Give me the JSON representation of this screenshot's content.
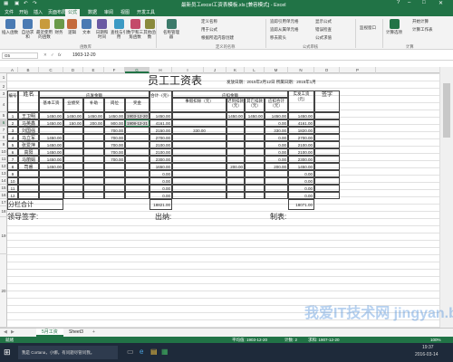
{
  "app": {
    "title": "最新员工excel工资表模板.xls  [兼容模式] - Excel",
    "file_tab": "文件"
  },
  "ribbon_tabs": [
    "文件",
    "开始",
    "插入",
    "页面布局",
    "公式",
    "数据",
    "审阅",
    "视图",
    "开发工具"
  ],
  "active_tab": "公式",
  "ribbon": {
    "buttons": [
      {
        "label": "插入函数",
        "color": "#4a7ab3"
      },
      {
        "label": "自动求和",
        "color": "#4a7ab3"
      },
      {
        "label": "最近使用的函数",
        "color": "#c89b3c"
      },
      {
        "label": "财务",
        "color": "#6a9a4a"
      },
      {
        "label": "逻辑",
        "color": "#c46a3c"
      },
      {
        "label": "文本",
        "color": "#4a7ab3"
      },
      {
        "label": "日期和时间",
        "color": "#6a5aa3"
      },
      {
        "label": "查找与引用",
        "color": "#3c9ac4"
      },
      {
        "label": "数学和三角函数",
        "color": "#c44a6a"
      },
      {
        "label": "其他函数",
        "color": "#8a8a3c"
      },
      {
        "label": "名称管理器",
        "color": "#3c7a6a"
      },
      {
        "label": "计算选项",
        "color": "#217346"
      }
    ],
    "small": {
      "define_name": "定义名称",
      "use_in_formula": "用于公式",
      "create_from_sel": "根据所选内容创建",
      "trace_precedents": "追踪引用单元格",
      "trace_dependents": "追踪从属单元格",
      "remove_arrows": "移去箭头",
      "show_formulas": "显示公式",
      "error_check": "错误检查",
      "evaluate": "公式求值",
      "watch": "监视窗口",
      "calc_now": "开始计算",
      "calc_sheet": "计算工作表"
    },
    "groups": [
      "函数库",
      "定义的名称",
      "公式审核",
      "计算"
    ]
  },
  "formula_bar": {
    "namebox": "G5",
    "fx": "fx",
    "value": "1903-12-20"
  },
  "columns": [
    "A",
    "B",
    "C",
    "D",
    "E",
    "F",
    "G",
    "H",
    "I",
    "J",
    "K",
    "L",
    "M",
    "N",
    "O",
    "P"
  ],
  "rows": [
    "1",
    "2",
    "3",
    "4",
    "5",
    "6",
    "7",
    "8",
    "9",
    "10",
    "11",
    "12",
    "13",
    "14",
    "15",
    "16",
    "17",
    "18",
    "19",
    "20"
  ],
  "sheet": {
    "title": "员工工资表",
    "issue_date": "发放日期：2015年2月12日 所属日期：2015年1月",
    "header": {
      "seq": "编号",
      "name": "姓名",
      "due": "应发金额",
      "basic": "基本工资",
      "merit": "业绩奖",
      "subsidy": "补助",
      "post": "岗位",
      "bonus": "奖金",
      "total": "合计（元）",
      "deduct": "应扣金额",
      "leave": "事假扣除（元）",
      "penalty": "迟到扣款（元）",
      "other": "其它扣款（元）",
      "deduct_total": "应扣合计（元）",
      "actual": "实发工资（元）",
      "sign": "签字"
    },
    "employees": [
      {
        "no": "1",
        "name": "王卫明",
        "basic": "1450.00",
        "merit": "1450.00",
        "subsidy": "1450.00",
        "post": "1450.00",
        "bonus": "1903-12-20",
        "total": "1450.00",
        "leave": "",
        "penalty": "1450.00",
        "other": "1450.00",
        "deduct_total": "1450.00",
        "actual": "1450.00"
      },
      {
        "no": "2",
        "name": "马英鑫",
        "basic": "1450.00",
        "merit": "150.00",
        "subsidy": "200.00",
        "post": "900.00",
        "bonus": "1908-12-21",
        "total": "4161.00",
        "leave": "",
        "penalty": "",
        "other": "",
        "deduct_total": "0.00",
        "actual": "4161.00"
      },
      {
        "no": "3",
        "name": "刘国强",
        "basic": "",
        "merit": "",
        "subsidy": "",
        "post": "700.00",
        "bonus": "",
        "total": "2150.00",
        "leave": "330.00",
        "penalty": "",
        "other": "",
        "deduct_total": "330.00",
        "actual": "1820.00"
      },
      {
        "no": "4",
        "name": "马立军",
        "basic": "1450.00",
        "merit": "",
        "subsidy": "",
        "post": "700.00",
        "bonus": "",
        "total": "2700.00",
        "leave": "",
        "penalty": "",
        "other": "",
        "deduct_total": "0.00",
        "actual": "2700.00"
      },
      {
        "no": "5",
        "name": "张爱萍",
        "basic": "1450.00",
        "merit": "",
        "subsidy": "",
        "post": "700.00",
        "bonus": "",
        "total": "2100.00",
        "leave": "",
        "penalty": "",
        "other": "",
        "deduct_total": "0.00",
        "actual": "2100.00"
      },
      {
        "no": "6",
        "name": "高阳",
        "basic": "1450.00",
        "merit": "",
        "subsidy": "",
        "post": "700.00",
        "bonus": "",
        "total": "2100.00",
        "leave": "",
        "penalty": "",
        "other": "",
        "deduct_total": "0.00",
        "actual": "2100.00"
      },
      {
        "no": "7",
        "name": "马丽娟",
        "basic": "1450.00",
        "merit": "",
        "subsidy": "",
        "post": "700.00",
        "bonus": "",
        "total": "2300.00",
        "leave": "",
        "penalty": "",
        "other": "",
        "deduct_total": "0.00",
        "actual": "2300.00"
      },
      {
        "no": "8",
        "name": "司睿",
        "basic": "1450.00",
        "merit": "",
        "subsidy": "",
        "post": "",
        "bonus": "",
        "total": "1650.00",
        "leave": "",
        "penalty": "200.00",
        "other": "",
        "deduct_total": "200.00",
        "actual": "1450.00"
      },
      {
        "no": "9",
        "name": "",
        "basic": "",
        "merit": "",
        "subsidy": "",
        "post": "",
        "bonus": "",
        "total": "0.00",
        "leave": "",
        "penalty": "",
        "other": "",
        "deduct_total": "",
        "actual": "0.00"
      },
      {
        "no": "10",
        "name": "",
        "basic": "",
        "merit": "",
        "subsidy": "",
        "post": "",
        "bonus": "",
        "total": "0.00",
        "leave": "",
        "penalty": "",
        "other": "",
        "deduct_total": "",
        "actual": "0.00"
      },
      {
        "no": "11",
        "name": "",
        "basic": "",
        "merit": "",
        "subsidy": "",
        "post": "",
        "bonus": "",
        "total": "0.00",
        "leave": "",
        "penalty": "",
        "other": "",
        "deduct_total": "",
        "actual": "0.00"
      },
      {
        "no": "12",
        "name": "",
        "basic": "",
        "merit": "",
        "subsidy": "",
        "post": "",
        "bonus": "",
        "total": "0.00",
        "leave": "",
        "penalty": "",
        "other": "",
        "deduct_total": "",
        "actual": "0.00"
      }
    ],
    "subtotal": {
      "label": "分栏合计",
      "total": "18821.00",
      "actual": "18071.00"
    },
    "footer": {
      "leader": "领导签字:",
      "cashier": "出纳:",
      "preparer": "制表:"
    }
  },
  "sheet_tabs": [
    "5月工资",
    "Sheet3"
  ],
  "add_sheet": "+",
  "status": {
    "left": "就绪",
    "avg": "平均值: 1903-12-20",
    "count": "计数: 2",
    "sum": "求和: 1907-12-20",
    "zoom": "100%"
  },
  "taskbar": {
    "search": "我是 Cortana，小娜。有问题尽管问我。",
    "time": "19:37",
    "date": "2016-03-14"
  },
  "watermark": "我爱IT技术网 jingyan.baidu.com"
}
